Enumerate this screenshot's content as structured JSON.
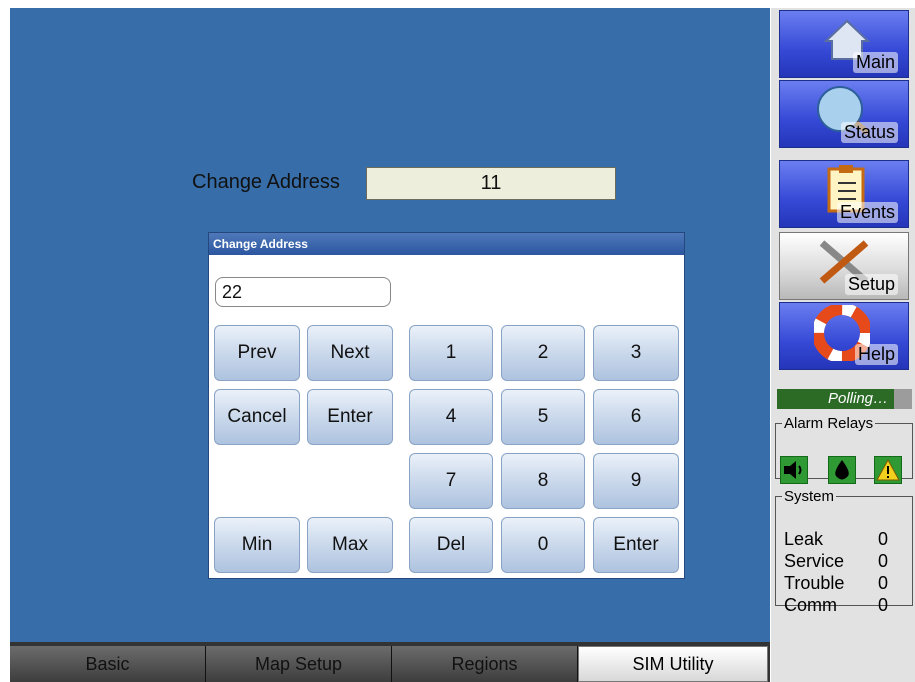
{
  "form": {
    "label": "Change Address",
    "value": "11"
  },
  "dialog": {
    "title": "Change Address",
    "input_value": "22",
    "keys": {
      "prev": "Prev",
      "next": "Next",
      "cancel": "Cancel",
      "enter_left": "Enter",
      "min": "Min",
      "max": "Max",
      "k1": "1",
      "k2": "2",
      "k3": "3",
      "k4": "4",
      "k5": "5",
      "k6": "6",
      "k7": "7",
      "k8": "8",
      "k9": "9",
      "del": "Del",
      "k0": "0",
      "enter_right": "Enter"
    }
  },
  "sidebar": {
    "nav": [
      {
        "label": "Main",
        "icon": "home-icon"
      },
      {
        "label": "Status",
        "icon": "magnifier-icon"
      },
      {
        "label": "Events",
        "icon": "clipboard-icon"
      },
      {
        "label": "Setup",
        "icon": "tools-icon",
        "active": true
      },
      {
        "label": "Help",
        "icon": "lifebuoy-icon"
      }
    ],
    "polling": "Polling…",
    "alarm_relays": {
      "title": "Alarm Relays",
      "icons": [
        "speaker-icon",
        "drop-icon",
        "warning-icon"
      ]
    },
    "system": {
      "title": "System",
      "rows": [
        {
          "label": "Leak",
          "value": "0"
        },
        {
          "label": "Service",
          "value": "0"
        },
        {
          "label": "Trouble",
          "value": "0"
        },
        {
          "label": "Comm",
          "value": "0"
        }
      ]
    }
  },
  "tabs": [
    {
      "label": "Basic"
    },
    {
      "label": "Map Setup"
    },
    {
      "label": "Regions"
    },
    {
      "label": "SIM Utility",
      "active": true
    }
  ],
  "colors": {
    "background": "#376da8",
    "nav_blue": "#3549d6",
    "polling_green": "#2b6b26",
    "relay_green": "#2f9a34"
  }
}
